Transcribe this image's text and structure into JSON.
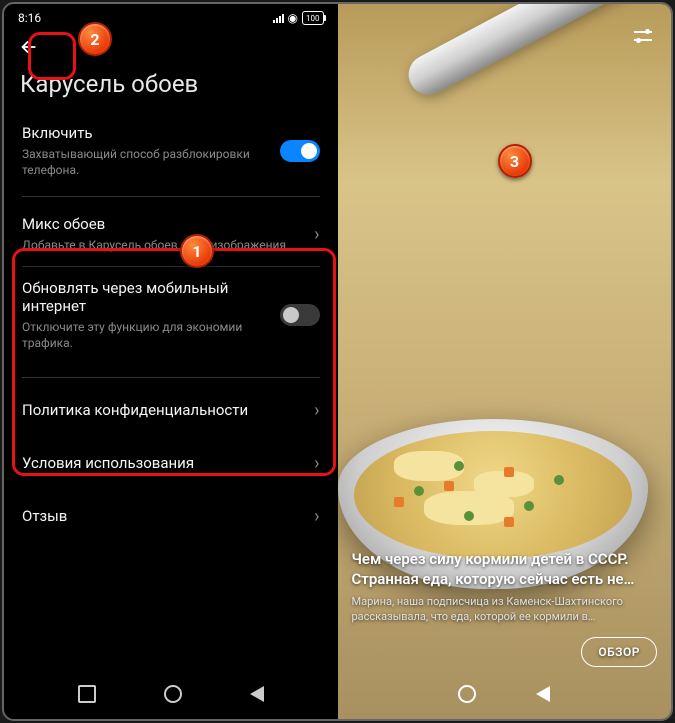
{
  "status": {
    "time": "8:16",
    "battery": "100"
  },
  "page_title": "Карусель обоев",
  "enable": {
    "title": "Включить",
    "sub": "Захватывающий способ разблокировки телефона.",
    "on": true
  },
  "mix": {
    "title": "Микс обоев",
    "sub": "Добавьте в Карусель обоев свои изображения"
  },
  "mobile": {
    "title": "Обновлять через мобильный интернет",
    "sub": "Отключите эту функцию для экономии трафика.",
    "on": false
  },
  "links": {
    "privacy": "Политика конфиденциальности",
    "terms": "Условия использования",
    "feedback": "Отзыв"
  },
  "article": {
    "title": "Чем через силу кормили детей в СССР. Странная еда, которую сейчас есть не…",
    "sub": "Марина, наша подписчица из Каменск-Шахтинского рассказывала, что еда, которой ее кормили в…",
    "button": "ОБЗОР"
  },
  "badges": {
    "b1": "1",
    "b2": "2",
    "b3": "3"
  }
}
